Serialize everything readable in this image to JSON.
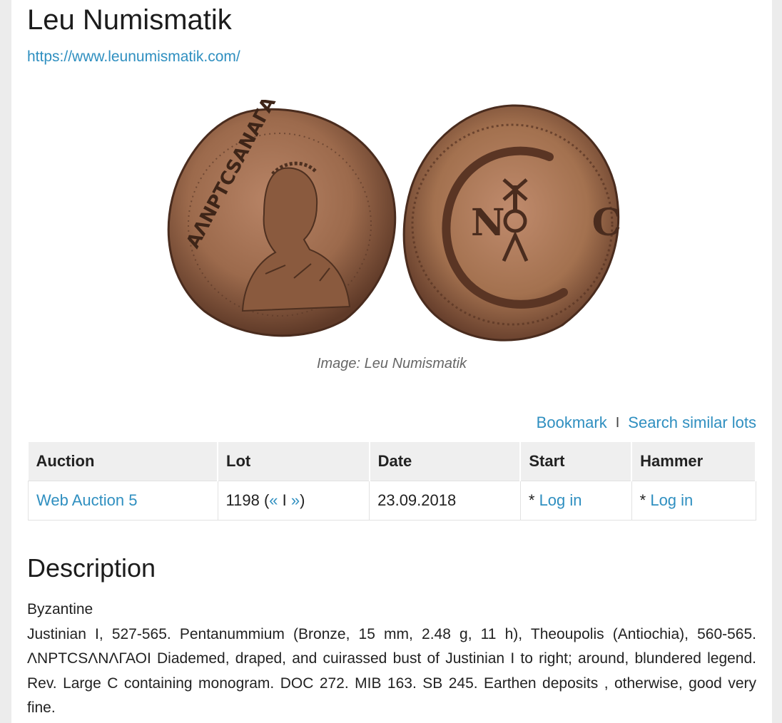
{
  "header": {
    "title": "Leu Numismatik",
    "url": "https://www.leunumismatik.com/"
  },
  "image": {
    "caption": "Image: Leu Numismatik",
    "obverse_legend": "AΛNPTCSANAΓAOI",
    "reverse_monogram": "N C"
  },
  "actions": {
    "bookmark": "Bookmark",
    "separator": "I",
    "search_similar": "Search similar lots"
  },
  "table": {
    "headers": {
      "auction": "Auction",
      "lot": "Lot",
      "date": "Date",
      "start": "Start",
      "hammer": "Hammer"
    },
    "row": {
      "auction": "Web Auction 5",
      "lot_number": "1198",
      "lot_open": " (",
      "prev": "«",
      "lot_sep": " I ",
      "next": "»",
      "lot_close": ")",
      "date": "23.09.2018",
      "start_prefix": "* ",
      "start_link": "Log in",
      "hammer_prefix": "* ",
      "hammer_link": "Log in"
    }
  },
  "description": {
    "heading": "Description",
    "category": "Byzantine",
    "text": "Justinian I, 527-565. Pentanummium (Bronze, 15 mm, 2.48 g, 11 h), Theoupolis (Antiochia), 560-565. ΛNPTCSΛNΛΓΑΟΙ Diademed, draped, and cuirassed bust of Justinian I to right; around, blundered legend. Rev. Large C containing monogram. DOC 272. MIB 163. SB 245. Earthen deposits , otherwise, good very fine."
  },
  "colors": {
    "link": "#2f8fc0",
    "table_header_bg": "#efefef",
    "page_bg": "#ececec",
    "coin_bronze": "#9c6a4c"
  }
}
